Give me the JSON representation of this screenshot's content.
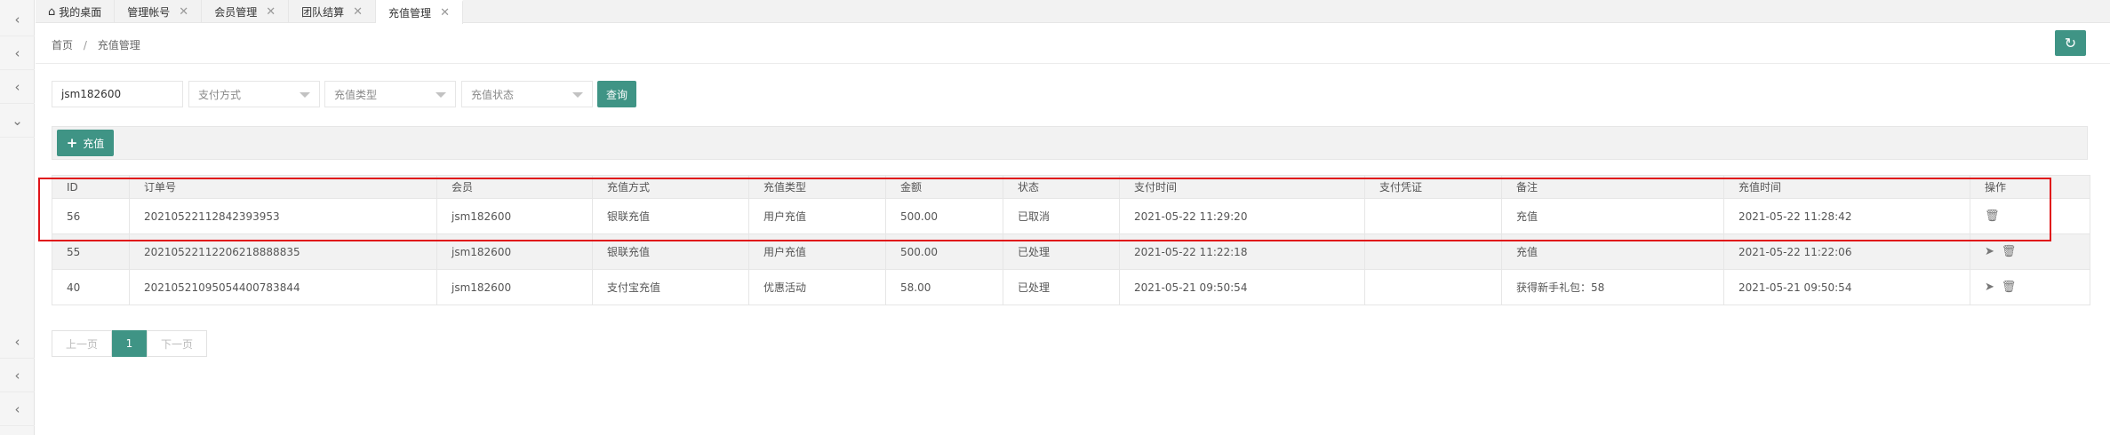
{
  "tabs": [
    {
      "label": "我的桌面",
      "home": true,
      "closable": false
    },
    {
      "label": "管理帐号",
      "closable": true
    },
    {
      "label": "会员管理",
      "closable": true
    },
    {
      "label": "团队结算",
      "closable": true
    },
    {
      "label": "充值管理",
      "closable": true,
      "active": true
    }
  ],
  "breadcrumb": {
    "home": "首页",
    "separator": "/",
    "current": "充值管理"
  },
  "filters": {
    "member_value": "jsm182600",
    "payment_method_placeholder": "支付方式",
    "recharge_type_placeholder": "充值类型",
    "recharge_status_placeholder": "充值状态",
    "query_label": "查询"
  },
  "toolbar": {
    "add_label": "充值"
  },
  "table": {
    "columns": [
      "ID",
      "订单号",
      "会员",
      "充值方式",
      "充值类型",
      "金额",
      "状态",
      "支付时间",
      "支付凭证",
      "备注",
      "充值时间",
      "操作"
    ],
    "rows": [
      {
        "id": "56",
        "order": "20210522112842393953",
        "member": "jsm182600",
        "method": "银联充值",
        "type": "用户充值",
        "amount": "500.00",
        "status": "已取消",
        "paid_at": "2021-05-22 11:29:20",
        "voucher": "",
        "note": "充值",
        "created_at": "2021-05-22 11:28:42",
        "actions": [
          "delete"
        ]
      },
      {
        "id": "55",
        "order": "20210522112206218888835",
        "member": "jsm182600",
        "method": "银联充值",
        "type": "用户充值",
        "amount": "500.00",
        "status": "已处理",
        "paid_at": "2021-05-22 11:22:18",
        "voucher": "",
        "note": "充值",
        "created_at": "2021-05-22 11:22:06",
        "actions": [
          "send",
          "delete"
        ]
      },
      {
        "id": "40",
        "order": "20210521095054400783844",
        "member": "jsm182600",
        "method": "支付宝充值",
        "type": "优惠活动",
        "amount": "58.00",
        "status": "已处理",
        "paid_at": "2021-05-21 09:50:54",
        "voucher": "",
        "note": "获得新手礼包：58",
        "created_at": "2021-05-21 09:50:54",
        "actions": [
          "send",
          "delete"
        ]
      }
    ]
  },
  "pager": {
    "prev": "上一页",
    "current": "1",
    "next": "下一页"
  },
  "colors": {
    "accent": "#3f9485",
    "highlight": "#e0141a"
  }
}
